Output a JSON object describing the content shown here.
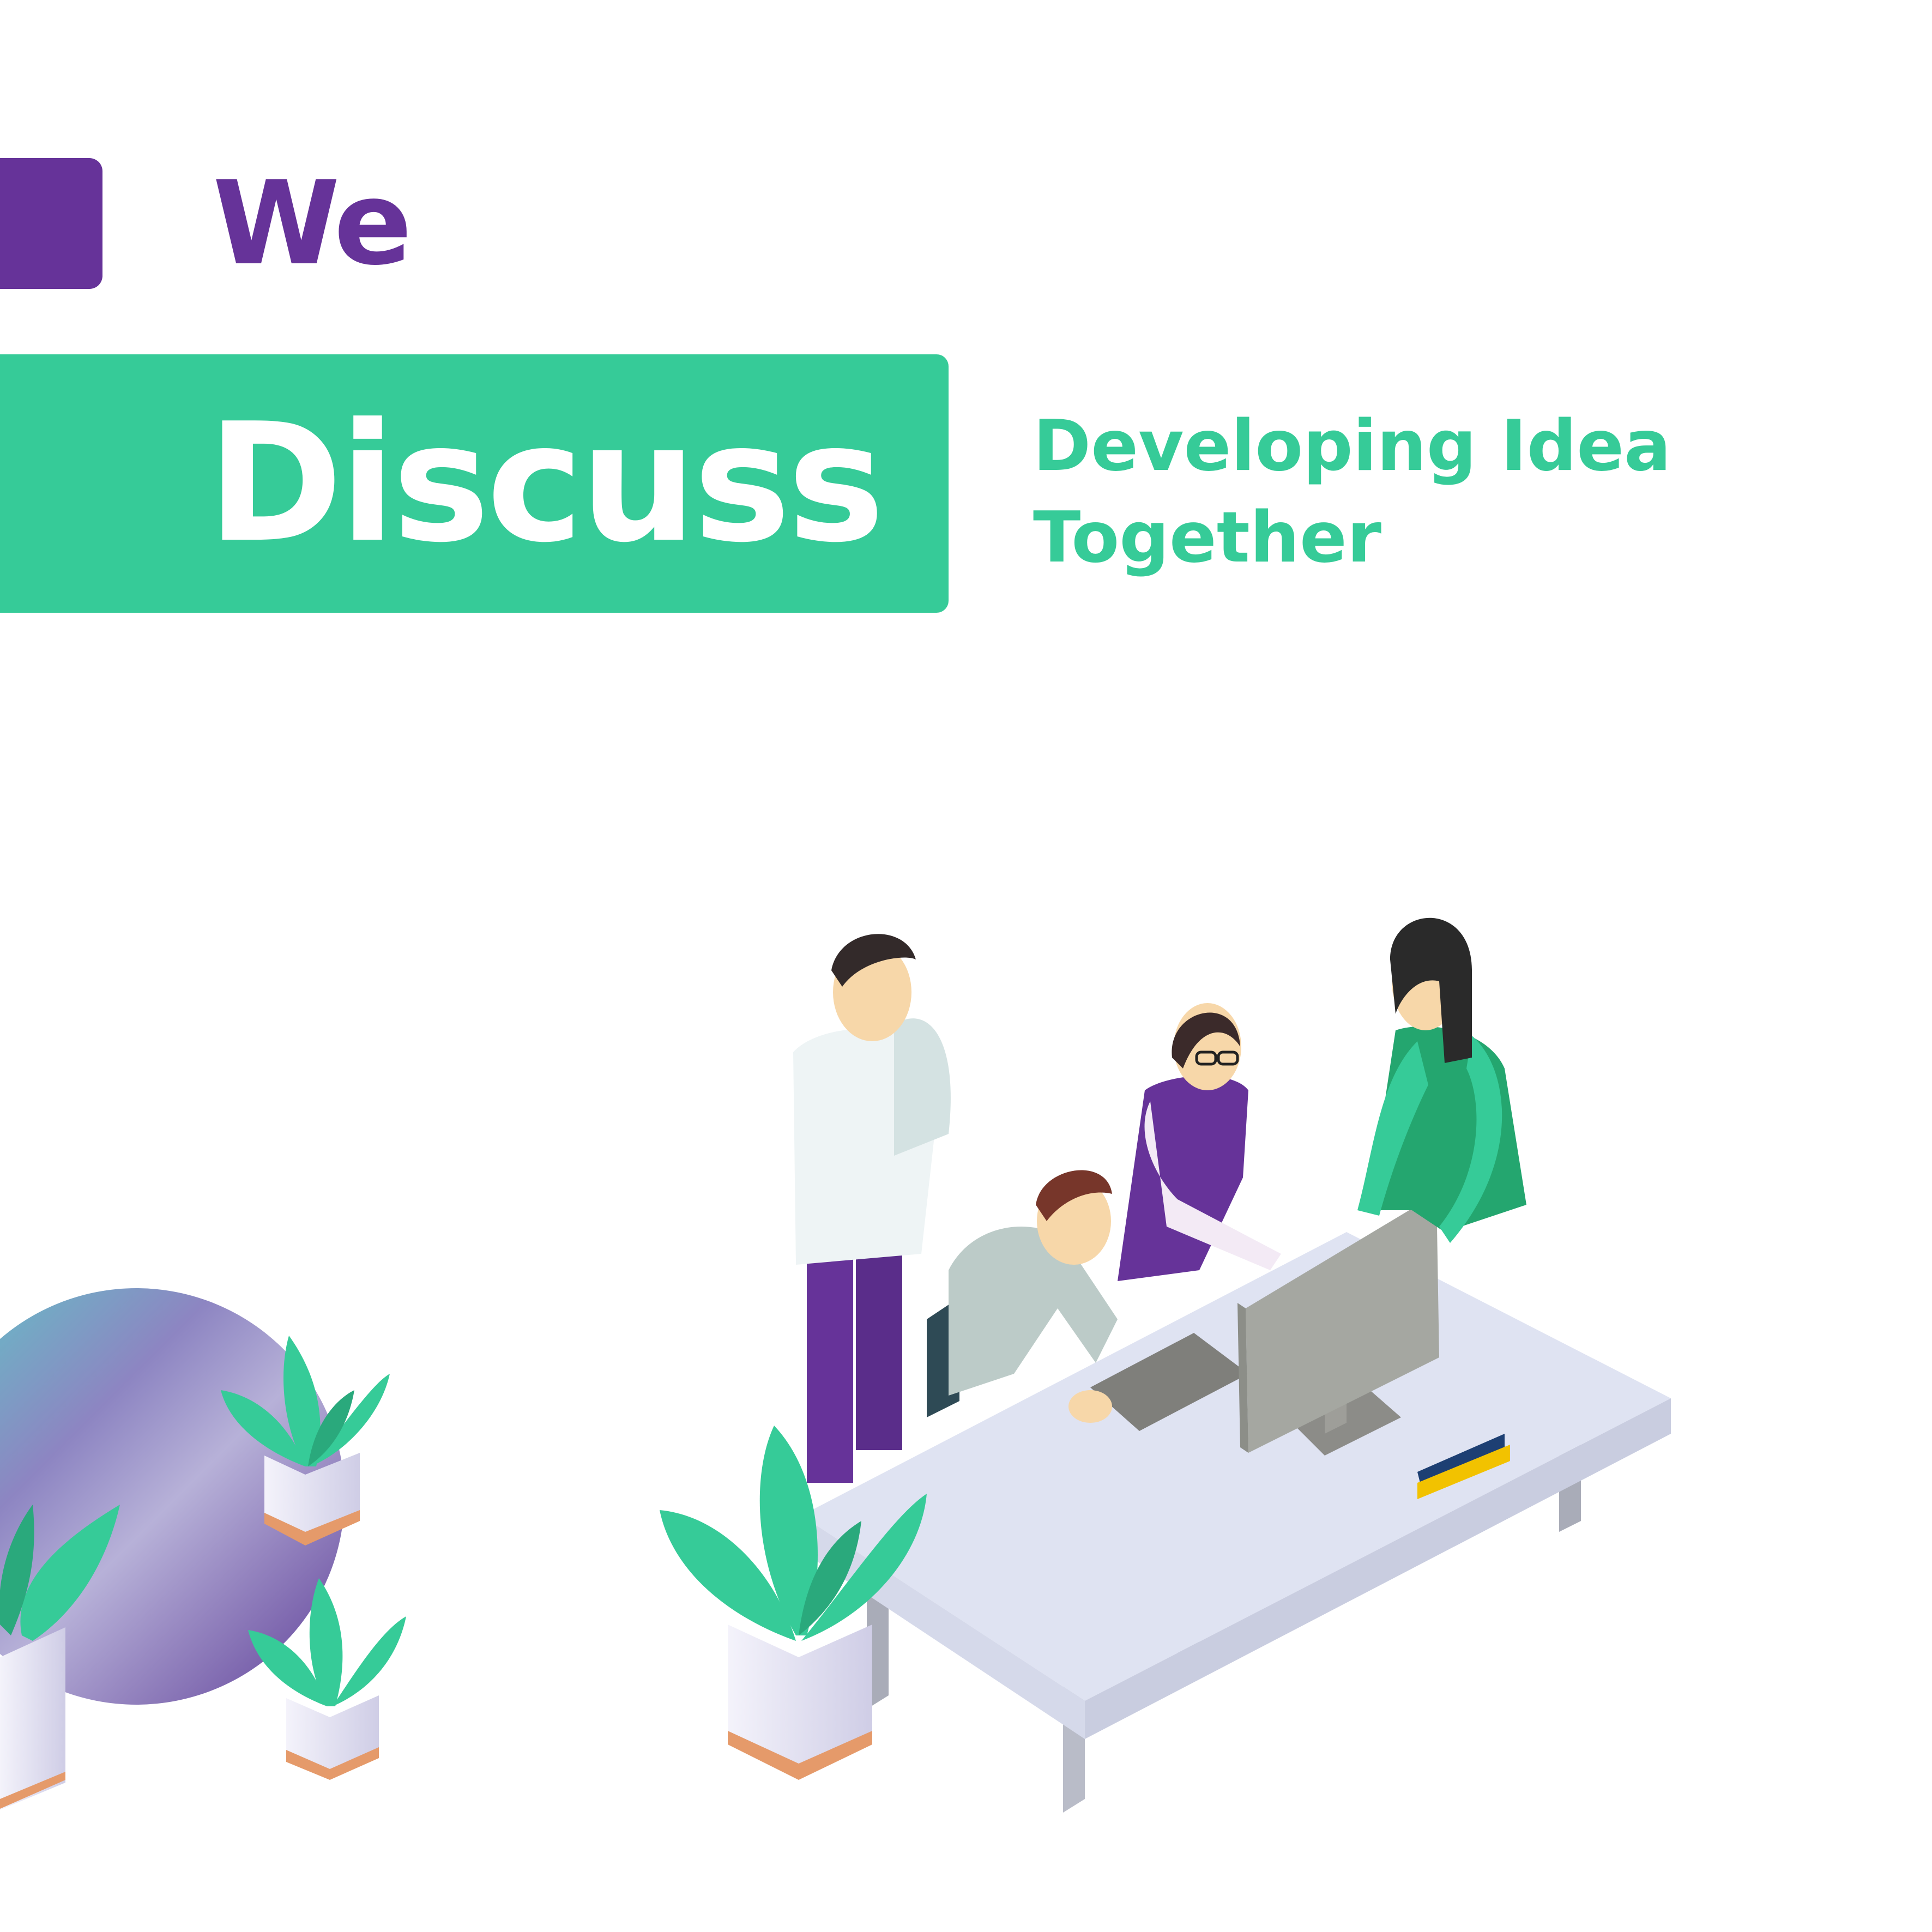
{
  "header": {
    "prefix_word": "We",
    "title": "Discuss",
    "tagline_line1": "Developing Idea",
    "tagline_line2": "Together"
  },
  "colors": {
    "purple": "#663399",
    "green": "#36cb98",
    "background": "#ffffff",
    "desk": "#dfe3f2"
  },
  "illustration": {
    "people_count": 4,
    "plants_count": 4,
    "icons": [
      "monitor-icon",
      "keyboard-icon",
      "plant-icon",
      "sphere-icon",
      "person-icon"
    ]
  }
}
